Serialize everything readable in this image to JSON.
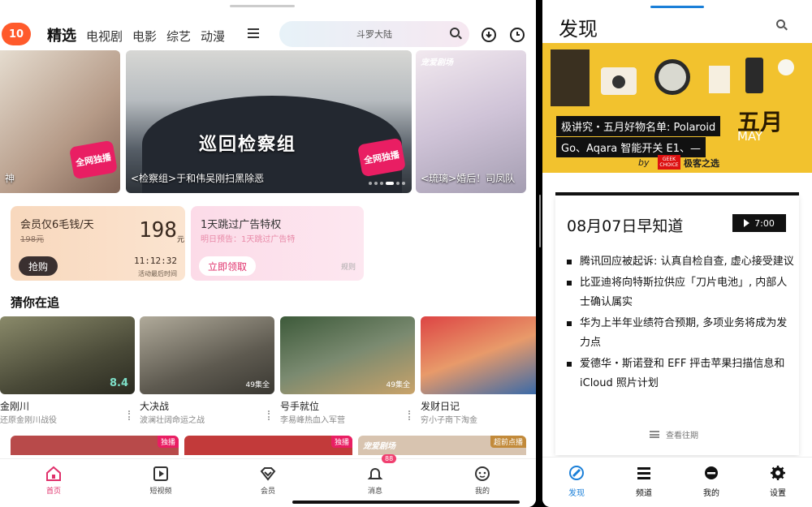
{
  "left_app": {
    "logo_text": "10",
    "categories": [
      "精选",
      "电视剧",
      "电影",
      "综艺",
      "动漫"
    ],
    "search_placeholder": "斗罗大陆",
    "banners": [
      {
        "caption": "神"
      },
      {
        "caption": "<检察组>于和伟吴刚扫黑除恶",
        "art_title": "巡回检察组",
        "stamp": "全网独播"
      },
      {
        "caption": "<琉璃>婚后！司凤队",
        "tag": "宠爱剧场",
        "stamp": "全网独播"
      }
    ],
    "promo_vip": {
      "title": "会员仅6毛钱/天",
      "original_price": "198元",
      "price": "198",
      "price_unit": "元",
      "button": "抢购",
      "countdown": "11:12:32",
      "countdown_label": "活动最后时间"
    },
    "promo_ad": {
      "title": "1天跳过广告特权",
      "subtitle": "明日预告：1天跳过广告特",
      "button": "立即领取",
      "rule": "规则"
    },
    "section_title": "猜你在追",
    "shows": [
      {
        "name": "金刚川",
        "desc": "还原金刚川战役",
        "score": "8.4"
      },
      {
        "name": "大决战",
        "desc": "波澜壮阔命运之战",
        "episodes": "49集全"
      },
      {
        "name": "号手就位",
        "desc": "李易峰热血入军营",
        "episodes": "49集全"
      },
      {
        "name": "发财日记",
        "desc": "穷小子南下淘金"
      }
    ],
    "row2_badges": [
      "独播",
      "独播",
      "超前点播"
    ],
    "row2_tag": "宠爱剧场",
    "bottom_nav": [
      {
        "label": "首页",
        "icon": "home-icon"
      },
      {
        "label": "短视频",
        "icon": "video-icon"
      },
      {
        "label": "会员",
        "icon": "vip-diamond-icon"
      },
      {
        "label": "消息",
        "icon": "bell-icon"
      },
      {
        "label": "我的",
        "icon": "profile-icon"
      }
    ],
    "notification_count": "88",
    "accent_color": "#e0306b"
  },
  "right_app": {
    "title": "发现",
    "banner": {
      "caption_line1": "极讲究・五月好物名单: Polaroid",
      "caption_line2": "Go、Aqara 智能开关 E1、—",
      "month": "五月",
      "month_en": "MAY",
      "by": "by",
      "brand_logo": "GEEK CHOICE",
      "brand": "极客之选"
    },
    "briefing": {
      "title": "08月07日早知道",
      "duration": "7:00",
      "items": [
        "腾讯回应被起诉: 认真自检自查, 虚心接受建议",
        "比亚迪将向特斯拉供应「刀片电池」, 内部人士确认属实",
        "华为上半年业绩符合预期, 多项业务将成为发力点",
        "爱德华・斯诺登和 EFF 抨击苹果扫描信息和 iCloud 照片计划"
      ],
      "history": "查看往期"
    },
    "bottom_nav": [
      {
        "label": "发现",
        "icon": "discover-icon"
      },
      {
        "label": "频道",
        "icon": "channels-icon"
      },
      {
        "label": "我的",
        "icon": "profile-icon"
      },
      {
        "label": "设置",
        "icon": "settings-gear-icon"
      }
    ],
    "accent_color": "#1a7fd8"
  }
}
